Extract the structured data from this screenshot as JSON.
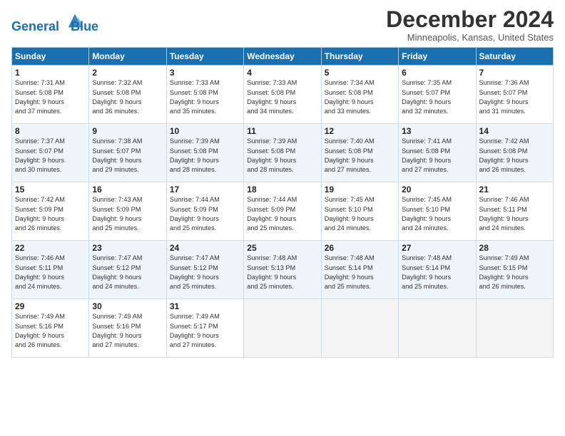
{
  "header": {
    "logo_line1": "General",
    "logo_line2": "Blue",
    "month_title": "December 2024",
    "location": "Minneapolis, Kansas, United States"
  },
  "weekdays": [
    "Sunday",
    "Monday",
    "Tuesday",
    "Wednesday",
    "Thursday",
    "Friday",
    "Saturday"
  ],
  "weeks": [
    [
      {
        "day": "1",
        "info": "Sunrise: 7:31 AM\nSunset: 5:08 PM\nDaylight: 9 hours\nand 37 minutes."
      },
      {
        "day": "2",
        "info": "Sunrise: 7:32 AM\nSunset: 5:08 PM\nDaylight: 9 hours\nand 36 minutes."
      },
      {
        "day": "3",
        "info": "Sunrise: 7:33 AM\nSunset: 5:08 PM\nDaylight: 9 hours\nand 35 minutes."
      },
      {
        "day": "4",
        "info": "Sunrise: 7:33 AM\nSunset: 5:08 PM\nDaylight: 9 hours\nand 34 minutes."
      },
      {
        "day": "5",
        "info": "Sunrise: 7:34 AM\nSunset: 5:08 PM\nDaylight: 9 hours\nand 33 minutes."
      },
      {
        "day": "6",
        "info": "Sunrise: 7:35 AM\nSunset: 5:07 PM\nDaylight: 9 hours\nand 32 minutes."
      },
      {
        "day": "7",
        "info": "Sunrise: 7:36 AM\nSunset: 5:07 PM\nDaylight: 9 hours\nand 31 minutes."
      }
    ],
    [
      {
        "day": "8",
        "info": "Sunrise: 7:37 AM\nSunset: 5:07 PM\nDaylight: 9 hours\nand 30 minutes."
      },
      {
        "day": "9",
        "info": "Sunrise: 7:38 AM\nSunset: 5:07 PM\nDaylight: 9 hours\nand 29 minutes."
      },
      {
        "day": "10",
        "info": "Sunrise: 7:39 AM\nSunset: 5:08 PM\nDaylight: 9 hours\nand 28 minutes."
      },
      {
        "day": "11",
        "info": "Sunrise: 7:39 AM\nSunset: 5:08 PM\nDaylight: 9 hours\nand 28 minutes."
      },
      {
        "day": "12",
        "info": "Sunrise: 7:40 AM\nSunset: 5:08 PM\nDaylight: 9 hours\nand 27 minutes."
      },
      {
        "day": "13",
        "info": "Sunrise: 7:41 AM\nSunset: 5:08 PM\nDaylight: 9 hours\nand 27 minutes."
      },
      {
        "day": "14",
        "info": "Sunrise: 7:42 AM\nSunset: 5:08 PM\nDaylight: 9 hours\nand 26 minutes."
      }
    ],
    [
      {
        "day": "15",
        "info": "Sunrise: 7:42 AM\nSunset: 5:09 PM\nDaylight: 9 hours\nand 26 minutes."
      },
      {
        "day": "16",
        "info": "Sunrise: 7:43 AM\nSunset: 5:09 PM\nDaylight: 9 hours\nand 25 minutes."
      },
      {
        "day": "17",
        "info": "Sunrise: 7:44 AM\nSunset: 5:09 PM\nDaylight: 9 hours\nand 25 minutes."
      },
      {
        "day": "18",
        "info": "Sunrise: 7:44 AM\nSunset: 5:09 PM\nDaylight: 9 hours\nand 25 minutes."
      },
      {
        "day": "19",
        "info": "Sunrise: 7:45 AM\nSunset: 5:10 PM\nDaylight: 9 hours\nand 24 minutes."
      },
      {
        "day": "20",
        "info": "Sunrise: 7:45 AM\nSunset: 5:10 PM\nDaylight: 9 hours\nand 24 minutes."
      },
      {
        "day": "21",
        "info": "Sunrise: 7:46 AM\nSunset: 5:11 PM\nDaylight: 9 hours\nand 24 minutes."
      }
    ],
    [
      {
        "day": "22",
        "info": "Sunrise: 7:46 AM\nSunset: 5:11 PM\nDaylight: 9 hours\nand 24 minutes."
      },
      {
        "day": "23",
        "info": "Sunrise: 7:47 AM\nSunset: 5:12 PM\nDaylight: 9 hours\nand 24 minutes."
      },
      {
        "day": "24",
        "info": "Sunrise: 7:47 AM\nSunset: 5:12 PM\nDaylight: 9 hours\nand 25 minutes."
      },
      {
        "day": "25",
        "info": "Sunrise: 7:48 AM\nSunset: 5:13 PM\nDaylight: 9 hours\nand 25 minutes."
      },
      {
        "day": "26",
        "info": "Sunrise: 7:48 AM\nSunset: 5:14 PM\nDaylight: 9 hours\nand 25 minutes."
      },
      {
        "day": "27",
        "info": "Sunrise: 7:48 AM\nSunset: 5:14 PM\nDaylight: 9 hours\nand 25 minutes."
      },
      {
        "day": "28",
        "info": "Sunrise: 7:49 AM\nSunset: 5:15 PM\nDaylight: 9 hours\nand 26 minutes."
      }
    ],
    [
      {
        "day": "29",
        "info": "Sunrise: 7:49 AM\nSunset: 5:16 PM\nDaylight: 9 hours\nand 26 minutes."
      },
      {
        "day": "30",
        "info": "Sunrise: 7:49 AM\nSunset: 5:16 PM\nDaylight: 9 hours\nand 27 minutes."
      },
      {
        "day": "31",
        "info": "Sunrise: 7:49 AM\nSunset: 5:17 PM\nDaylight: 9 hours\nand 27 minutes."
      },
      {
        "day": "",
        "info": ""
      },
      {
        "day": "",
        "info": ""
      },
      {
        "day": "",
        "info": ""
      },
      {
        "day": "",
        "info": ""
      }
    ]
  ]
}
